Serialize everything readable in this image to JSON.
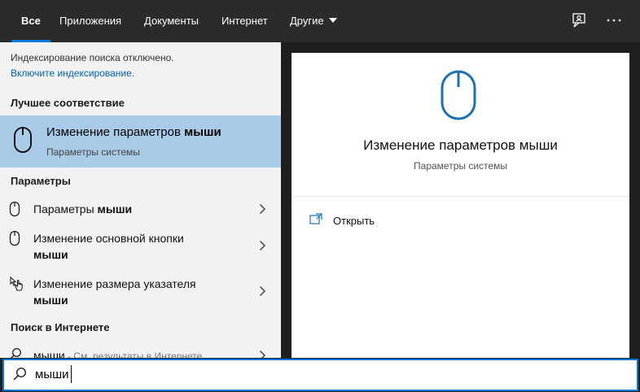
{
  "tabs": [
    {
      "label": "Все"
    },
    {
      "label": "Приложения"
    },
    {
      "label": "Документы"
    },
    {
      "label": "Интернет"
    },
    {
      "label": "Другие"
    }
  ],
  "notice": {
    "text": "Индексирование поиска отключено.",
    "link": "Включите индексирование."
  },
  "best_match": {
    "header": "Лучшее соответствие",
    "title_plain": "Изменение параметров ",
    "title_bold": "мыши",
    "subtitle": "Параметры системы"
  },
  "settings": {
    "header": "Параметры",
    "items": [
      {
        "line1_plain": "Параметры ",
        "line1_bold": "мыши",
        "line2_bold": "",
        "icon": "mouse-icon"
      },
      {
        "line1_plain": "Изменение основной кнопки",
        "line1_bold": "",
        "line2_bold": "мыши",
        "icon": "mouse-icon"
      },
      {
        "line1_plain": "Изменение размера указателя",
        "line1_bold": "",
        "line2_bold": "мыши",
        "icon": "pointer-hand-icon"
      }
    ]
  },
  "web": {
    "header": "Поиск в Интернете",
    "query": "мыши",
    "suffix": " - См. результаты в Интернете"
  },
  "preview": {
    "title": "Изменение параметров мыши",
    "subtitle": "Параметры системы",
    "action": "Открыть"
  },
  "search": {
    "value": "мыши"
  },
  "colors": {
    "accent": "#0078d7",
    "highlight": "#a9cbe8",
    "topbar": "#2b2b2b"
  }
}
